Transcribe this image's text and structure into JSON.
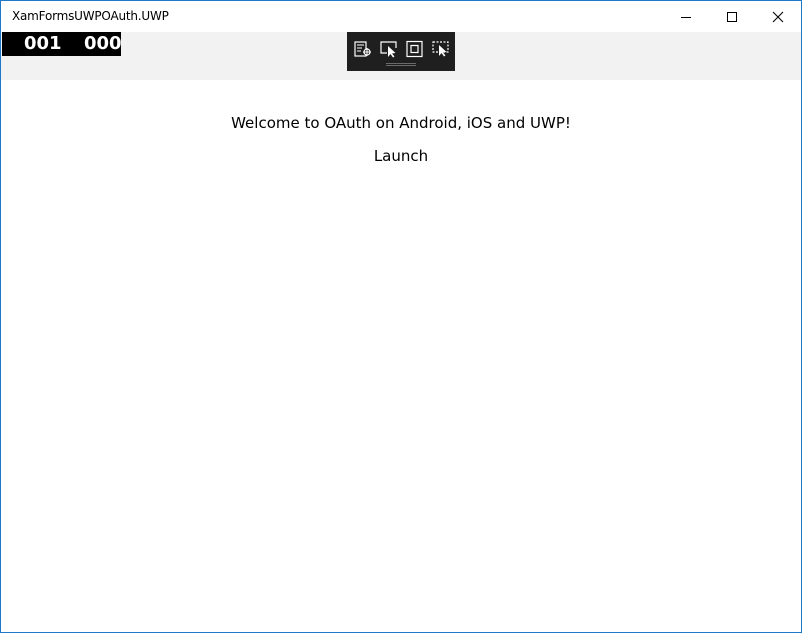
{
  "window": {
    "title": "XamFormsUWPOAuth.UWP",
    "accent_border_color": "#1e78c8",
    "controls": {
      "minimize_icon": "minimize-icon",
      "maximize_icon": "maximize-icon",
      "close_icon": "close-icon"
    }
  },
  "frame_counter": {
    "left_value": "001",
    "right_value": "000"
  },
  "debug_toolbar": {
    "icons": [
      "live-visual-tree-icon",
      "select-element-icon",
      "display-layout-adorners-icon",
      "track-focused-element-icon"
    ]
  },
  "main": {
    "welcome_text": "Welcome to OAuth on Android, iOS and UWP!",
    "launch_label": "Launch"
  },
  "colors": {
    "header_bar": "#f2f2f2",
    "toolbar_bg": "#1f1f1f",
    "frame_counter_bg": "#000000"
  }
}
